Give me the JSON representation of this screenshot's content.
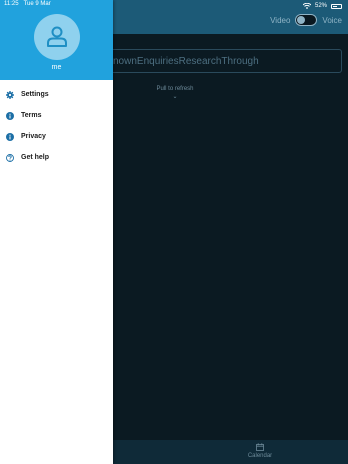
{
  "status_bar": {
    "time": "11:25",
    "date": "Tue 9 Mar",
    "battery": "52%",
    "battery_level": 0.52
  },
  "header": {
    "toggle_left_label": "Video",
    "toggle_right_label": "Voice"
  },
  "search": {
    "value": "nownEnquiriesResearchThrough"
  },
  "main": {
    "pull_to_refresh": "Pull to refresh"
  },
  "bottom_nav": {
    "calendar_label": "Calendar"
  },
  "drawer": {
    "user_name": "me",
    "items": [
      {
        "label": "Settings",
        "icon": "gear-icon"
      },
      {
        "label": "Terms",
        "icon": "info-icon"
      },
      {
        "label": "Privacy",
        "icon": "info-icon"
      },
      {
        "label": "Get help",
        "icon": "help-icon"
      }
    ]
  },
  "colors": {
    "drawer_header": "#21a2dd",
    "app_header": "#1c5a77",
    "background": "#0b1a22",
    "icon_accent": "#1c6fa6"
  }
}
